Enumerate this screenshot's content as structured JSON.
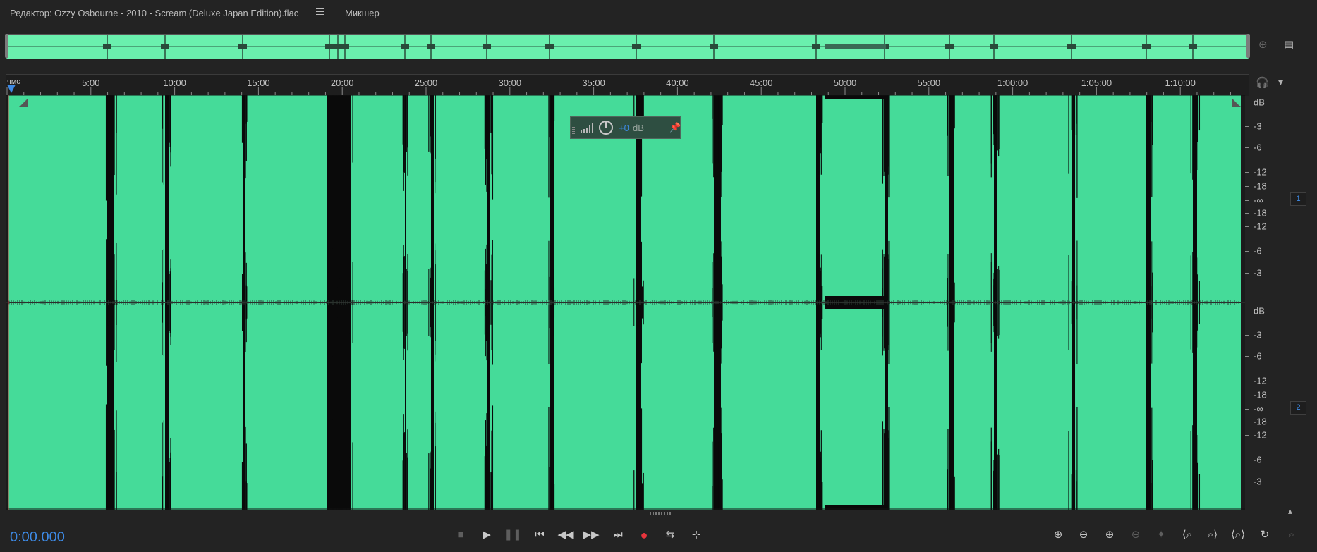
{
  "tabs": {
    "editor_label": "Редактор: Ozzy Osbourne - 2010 - Scream (Deluxe Japan Edition).flac",
    "mixer_label": "Микшер"
  },
  "ruler": {
    "unit_label": "чмс",
    "ticks": [
      "5:00",
      "10:00",
      "15:00",
      "20:00",
      "25:00",
      "30:00",
      "35:00",
      "40:00",
      "45:00",
      "50:00",
      "55:00",
      "1:00:00",
      "1:05:00",
      "1:10:00"
    ]
  },
  "hud": {
    "value": "+0",
    "unit": "dB"
  },
  "db_scale": {
    "channel_1": {
      "labels": [
        "dB",
        "-3",
        "-6",
        "-12",
        "-18",
        "-∞",
        "-18",
        "-12",
        "-6",
        "-3"
      ],
      "badge": "1"
    },
    "channel_2": {
      "labels": [
        "dB",
        "-3",
        "-6",
        "-12",
        "-18",
        "-∞",
        "-18",
        "-12",
        "-6",
        "-3"
      ],
      "badge": "2"
    }
  },
  "transport": {
    "timecode": "0:00.000"
  },
  "colors": {
    "waveform": "#45db99",
    "overview": "#6af0ae",
    "accent": "#3d8ae5",
    "record": "#e8343c"
  },
  "icons": {
    "stop": "stop-icon",
    "play": "play-icon",
    "pause": "pause-icon",
    "to_start": "skip-to-start-icon",
    "rewind": "rewind-icon",
    "fast_forward": "fast-forward-icon",
    "to_end": "skip-to-end-icon",
    "record": "record-icon",
    "loop": "loop-icon",
    "skip": "skip-selection-icon"
  }
}
